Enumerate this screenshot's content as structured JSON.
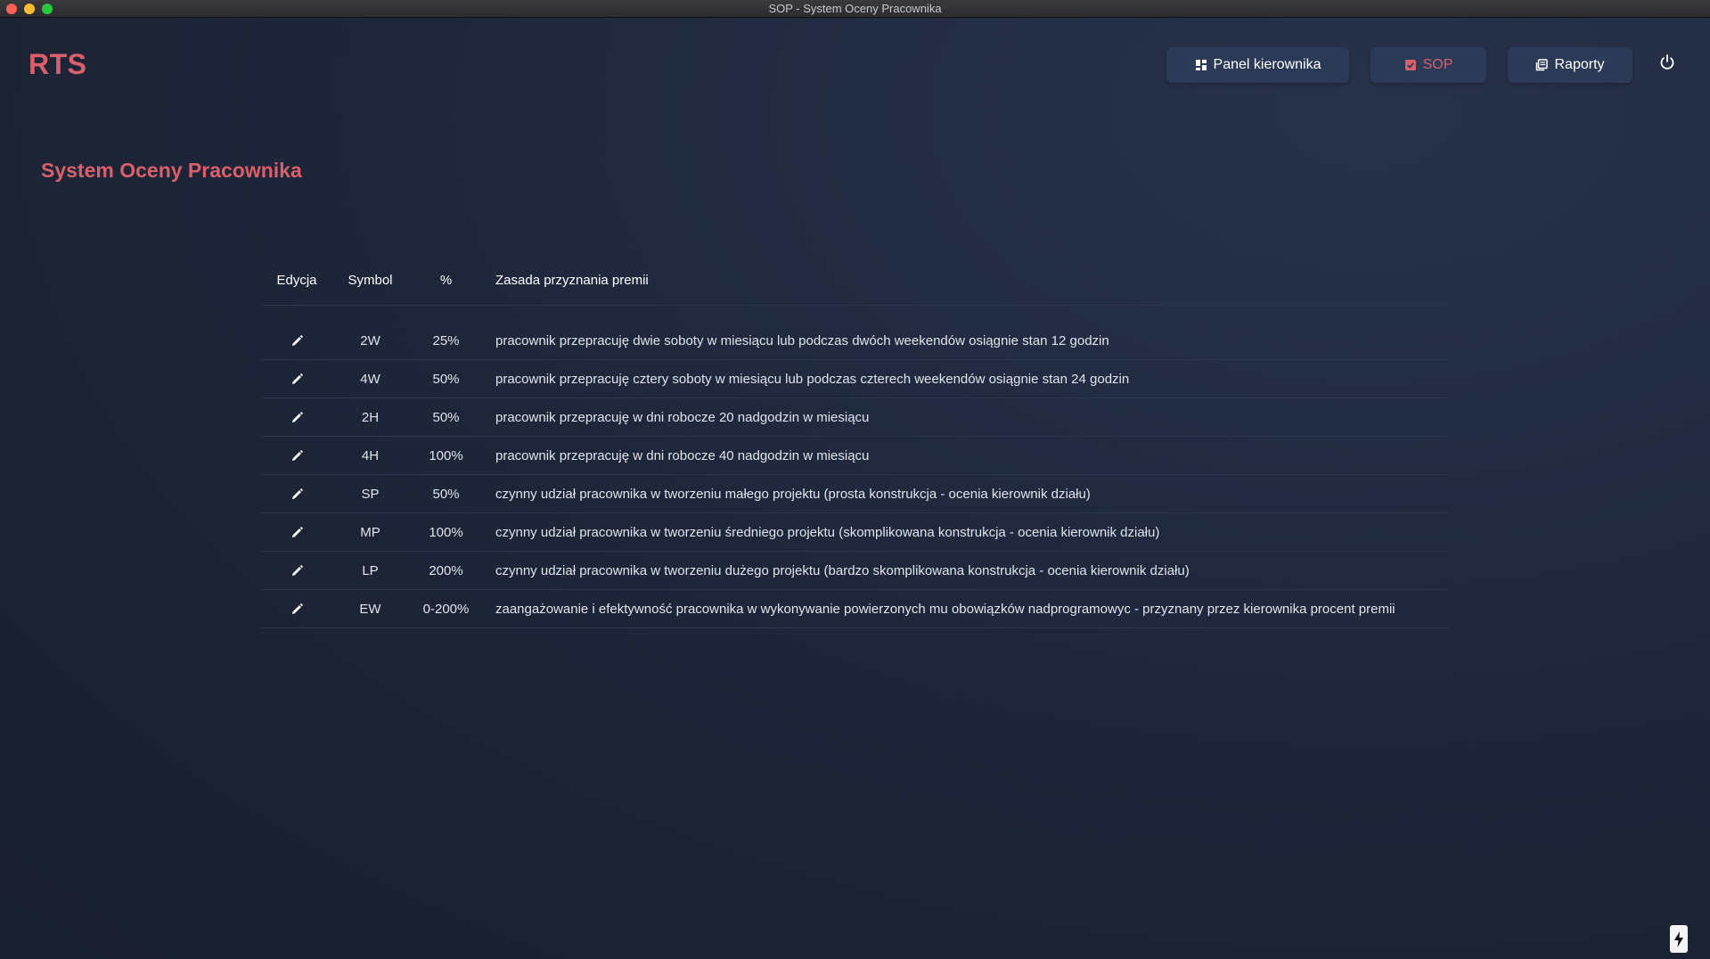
{
  "window": {
    "title": "SOP - System Oceny Pracownika"
  },
  "header": {
    "logo": "RTS",
    "nav": {
      "panel": "Panel kierownika",
      "sop": "SOP",
      "raporty": "Raporty"
    },
    "icons": {
      "panel": "dashboard-icon",
      "sop": "checkbox-icon",
      "raporty": "reports-icon",
      "power": "power-icon"
    }
  },
  "main": {
    "title": "System Oceny Pracownika",
    "table": {
      "columns": {
        "edit": "Edycja",
        "symbol": "Symbol",
        "percent": "%",
        "rule": "Zasada przyznania premii"
      },
      "rows": [
        {
          "symbol": "2W",
          "percent": "25%",
          "rule": "pracownik przepracuję dwie soboty w miesiącu lub podczas dwóch weekendów osiągnie stan 12 godzin"
        },
        {
          "symbol": "4W",
          "percent": "50%",
          "rule": "pracownik przepracuję cztery soboty w miesiącu lub podczas czterech weekendów osiągnie stan 24 godzin"
        },
        {
          "symbol": "2H",
          "percent": "50%",
          "rule": "pracownik przepracuję w dni robocze 20 nadgodzin w miesiącu"
        },
        {
          "symbol": "4H",
          "percent": "100%",
          "rule": "pracownik przepracuję w dni robocze 40 nadgodzin w miesiącu"
        },
        {
          "symbol": "SP",
          "percent": "50%",
          "rule": "czynny udział pracownika w tworzeniu małego projektu (prosta konstrukcja - ocenia kierownik działu)"
        },
        {
          "symbol": "MP",
          "percent": "100%",
          "rule": "czynny udział pracownika w tworzeniu średniego projektu (skomplikowana konstrukcja - ocenia kierownik działu)"
        },
        {
          "symbol": "LP",
          "percent": "200%",
          "rule": "czynny udział pracownika w tworzeniu dużego projektu (bardzo skomplikowana konstrukcja - ocenia kierownik działu)"
        },
        {
          "symbol": "EW",
          "percent": "0-200%",
          "rule": "zaangażowanie i efektywność pracownika w wykonywanie powierzonych mu obowiązków nadprogramowyc - przyznany przez kierownika procent premii"
        }
      ]
    }
  },
  "colors": {
    "accent": "#d95f6b",
    "background": "#1b2337",
    "button": "#2b3a57"
  }
}
